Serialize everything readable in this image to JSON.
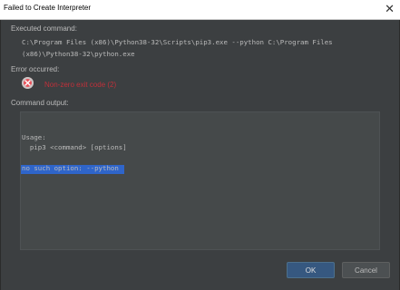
{
  "window": {
    "title": "Failed to Create Interpreter",
    "close_glyph": "✕"
  },
  "executed": {
    "label": "Executed command:",
    "line1": "C:\\Program Files (x86)\\Python38-32\\Scripts\\pip3.exe --python C:\\Program Files",
    "line2": "(x86)\\Python38-32\\python.exe"
  },
  "error": {
    "label": "Error occurred:",
    "icon": "error-icon",
    "message": "Non-zero exit code (2)"
  },
  "output": {
    "label": "Command output:",
    "usage_line": "Usage:",
    "usage_detail": "  pip3 <command> [options]",
    "selected_line": "no such option: --python"
  },
  "buttons": {
    "ok": "OK",
    "cancel": "Cancel"
  },
  "colors": {
    "background": "#3c3f41",
    "error_text": "#c0303a",
    "ok_button": "#365880",
    "selection": "#2f65ca"
  }
}
